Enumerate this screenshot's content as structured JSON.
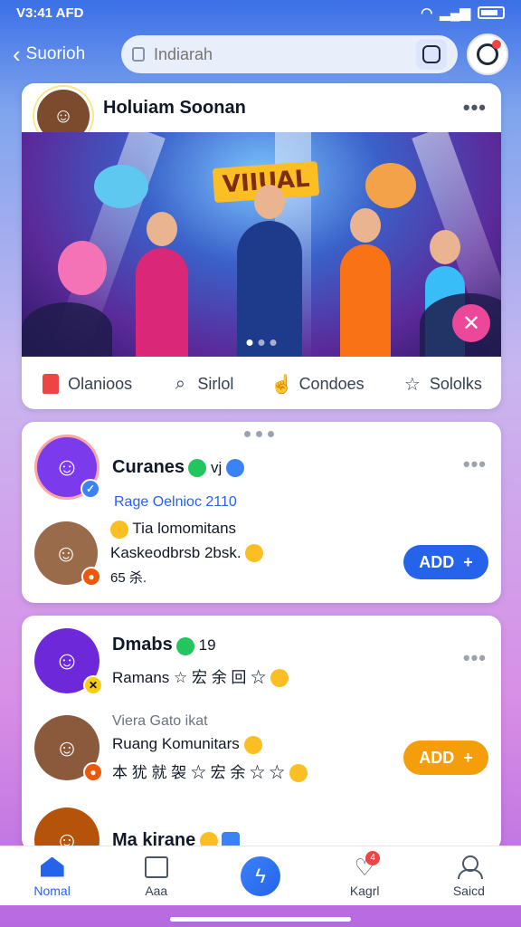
{
  "status_bar": {
    "time": "V3:41 AFD"
  },
  "top_bar": {
    "back_label": "Suorioh",
    "search_placeholder": "Indiarah"
  },
  "post": {
    "author": "Holuiam Soonan",
    "hero_sign": "VIIUAL",
    "actions": [
      {
        "label": "Olanioos",
        "icon": "red-bookmark-icon"
      },
      {
        "label": "Sirlol",
        "icon": "search-icon"
      },
      {
        "label": "Condoes",
        "icon": "thumb-icon"
      },
      {
        "label": "Sololks",
        "icon": "star-icon"
      }
    ]
  },
  "card2": {
    "name": "Curanes",
    "name_extra": "vj",
    "subtitle": "Rage Oelnioc 2110",
    "line1": "Tia lomomitans",
    "line2": "Kaskeodbrsb 2bsk.",
    "line3": "65 杀.",
    "button": "ADD"
  },
  "card3": {
    "name": "Dmabs",
    "name_extra": "19",
    "line1": "Ramans ☆ 宏 余 回 ☆",
    "meta": "Viera Gato ikat",
    "title": "Ruang Komunitars",
    "line2": "本 犹 就 袈 ☆ 宏 余 ☆ ☆",
    "button": "ADD",
    "next_name": "Ma kirane"
  },
  "bottom_nav": [
    {
      "label": "Nomal",
      "active": true
    },
    {
      "label": "Aaa"
    },
    {
      "label": ""
    },
    {
      "label": "Kagrl",
      "badge": "4"
    },
    {
      "label": "Saicd"
    }
  ],
  "colors": {
    "accent": "#2563eb",
    "orange": "#f59e0b",
    "pink": "#ec4899"
  }
}
